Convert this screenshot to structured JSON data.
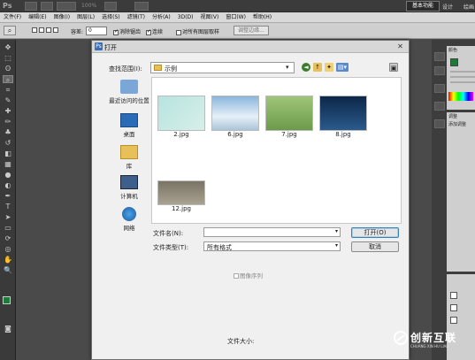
{
  "titlebar": {
    "app_logo": "Ps",
    "zoom": "100%",
    "workspace": "基本功能",
    "design": "设计",
    "draw": "绘画"
  },
  "menu": [
    "文件(F)",
    "编辑(E)",
    "图像(I)",
    "图层(L)",
    "选择(S)",
    "滤镜(T)",
    "分析(A)",
    "3D(D)",
    "视图(V)",
    "窗口(W)",
    "帮助(H)"
  ],
  "options": {
    "tolerance_label": "容差:",
    "tolerance_value": "0",
    "antialias": "消除锯齿",
    "contiguous": "连续",
    "sample_all": "对所有图层取样",
    "refine": "调整边缘..."
  },
  "right_panels": {
    "color_tab": "颜色",
    "adjust_tab": "调整",
    "adjust_add": "添加调整"
  },
  "dialog": {
    "title": "打开",
    "lookin_label": "查找范围(I):",
    "lookin_value": "示例",
    "places": [
      {
        "label": "最近访问的位置",
        "icon": "recent-places-icon"
      },
      {
        "label": "桌面",
        "icon": "desktop-icon"
      },
      {
        "label": "库",
        "icon": "libraries-icon"
      },
      {
        "label": "计算机",
        "icon": "computer-icon"
      },
      {
        "label": "网络",
        "icon": "network-icon"
      }
    ],
    "files": [
      {
        "name": "2.jpg"
      },
      {
        "name": "6.jpg"
      },
      {
        "name": "7.jpg"
      },
      {
        "name": "8.jpg"
      },
      {
        "name": "12.jpg"
      }
    ],
    "filename_label": "文件名(N):",
    "filename_value": "",
    "filetype_label": "文件类型(T):",
    "filetype_value": "所有格式",
    "open_button": "打开(O)",
    "cancel_button": "取消",
    "image_sequence": "图像序列",
    "file_size_label": "文件大小:"
  },
  "watermark": {
    "text": "创新互联",
    "sub": "CHUANG XIN HU LIAN"
  }
}
